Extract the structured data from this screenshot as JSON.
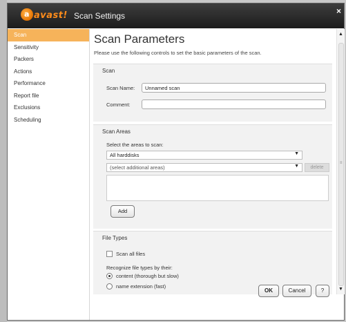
{
  "window": {
    "brand": "avast!",
    "title": "Scan Settings",
    "close_glyph": "×"
  },
  "sidebar": {
    "items": [
      {
        "label": "Scan",
        "active": true
      },
      {
        "label": "Sensitivity"
      },
      {
        "label": "Packers"
      },
      {
        "label": "Actions"
      },
      {
        "label": "Performance"
      },
      {
        "label": "Report file"
      },
      {
        "label": "Exclusions"
      },
      {
        "label": "Scheduling"
      }
    ]
  },
  "main": {
    "title": "Scan Parameters",
    "description": "Please use the following controls to set the basic parameters of the scan.",
    "scan_group": {
      "label": "Scan",
      "name_label": "Scan Name:",
      "name_value": "Unnamed scan",
      "comment_label": "Comment:",
      "comment_value": ""
    },
    "areas_group": {
      "label": "Scan Areas",
      "select_label": "Select the areas to scan:",
      "primary_value": "All harddisks",
      "additional_placeholder": "(select additional areas)",
      "delete_label": "delete",
      "add_label": "Add"
    },
    "file_types_group": {
      "label": "File Types",
      "scan_all_label": "Scan all files",
      "scan_all_checked": false,
      "recognize_label": "Recognize file types by their:",
      "options": [
        {
          "label": "content (thorough but slow)",
          "selected": true
        },
        {
          "label": "name extension (fast)",
          "selected": false
        }
      ]
    }
  },
  "footer": {
    "ok_label": "OK",
    "cancel_label": "Cancel",
    "help_label": "?"
  },
  "colors": {
    "accent": "#f6b35a",
    "titlebar": "#2b2b2b",
    "brand": "#ff8c1a"
  }
}
